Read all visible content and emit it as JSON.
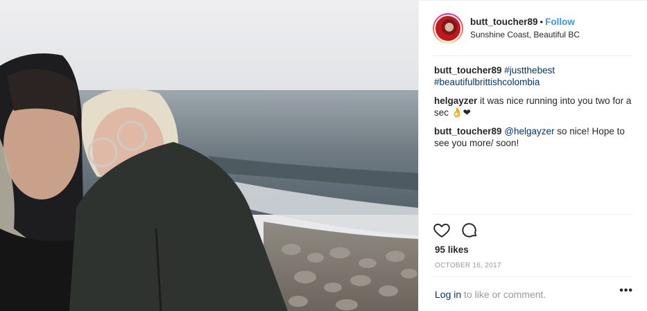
{
  "post": {
    "username": "butt_toucher89",
    "follow_label": "Follow",
    "location": "Sunshine Coast, Beautiful BC",
    "caption": {
      "user": "butt_toucher89",
      "hashtag1": "#justthebest",
      "hashtag2": "#beautifulbrittishcolombia"
    },
    "comments": [
      {
        "user": "helgayzer",
        "text": " it was nice running into you two for a sec 👌❤"
      },
      {
        "user": "butt_toucher89",
        "mention": "@helgayzer",
        "text": " so nice! Hope to see you more/ soon!"
      }
    ],
    "likes": "95 likes",
    "date": "OCTOBER 16, 2017",
    "login_link": "Log in",
    "login_suffix": " to like or comment.",
    "more_label": "•••"
  },
  "icons": {
    "like": "heart-icon",
    "comment": "comment-bubble-icon"
  },
  "colors": {
    "follow": "#3897f0",
    "link": "#003569",
    "muted": "#999999"
  }
}
